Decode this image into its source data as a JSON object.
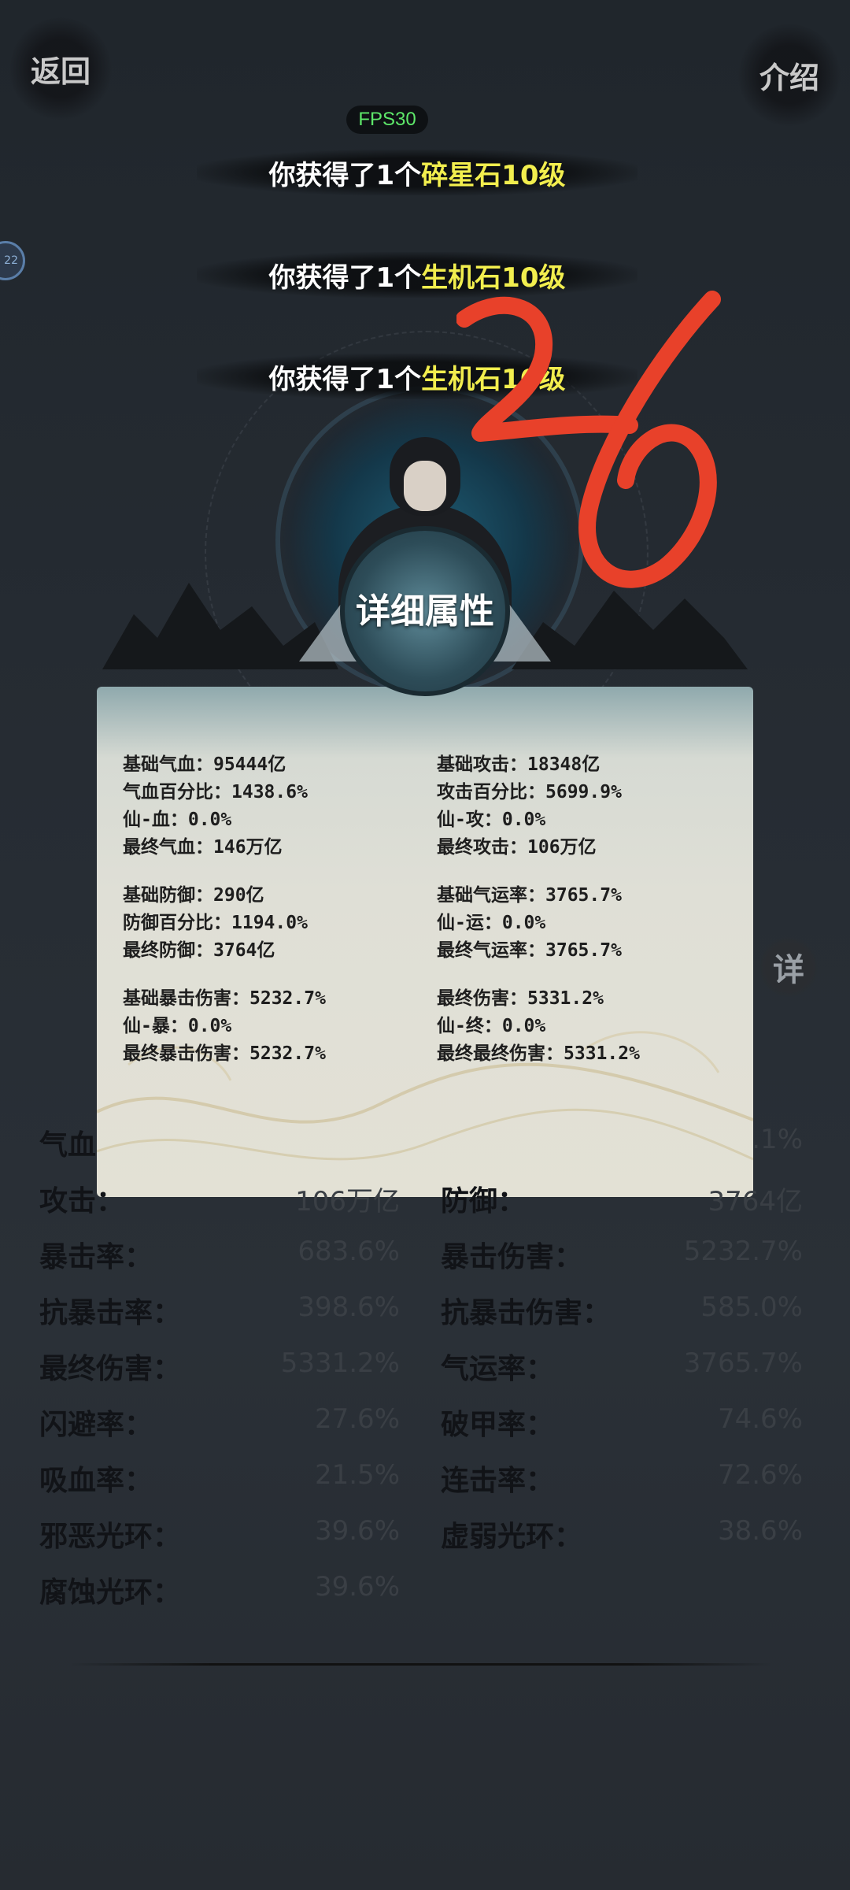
{
  "header": {
    "back_label": "返回",
    "intro_label": "介绍",
    "fps": "FPS30"
  },
  "side_chip": "22",
  "notices": [
    {
      "prefix": "你获得了1个",
      "item": "碎星石10级"
    },
    {
      "prefix": "你获得了1个",
      "item": "生机石10级"
    },
    {
      "prefix": "你获得了1个",
      "item": "生机石10级"
    }
  ],
  "panel": {
    "title": "详细属性",
    "left_groups": [
      [
        "基础气血：95444亿",
        "气血百分比：1438.6%",
        "仙-血：0.0%",
        "最终气血：146万亿"
      ],
      [
        "基础防御：290亿",
        "防御百分比：1194.0%",
        "最终防御：3764亿"
      ],
      [
        "基础暴击伤害：5232.7%",
        "仙-暴：0.0%",
        "最终暴击伤害：5232.7%"
      ]
    ],
    "right_groups": [
      [
        "基础攻击：18348亿",
        "攻击百分比：5699.9%",
        "仙-攻：0.0%",
        "最终攻击：106万亿"
      ],
      [
        "基础气运率：3765.7%",
        "仙-运：0.0%",
        "最终气运率：3765.7%"
      ],
      [
        "最终伤害：5331.2%",
        "仙-终：0.0%",
        "最终最终伤害：5331.2%"
      ]
    ]
  },
  "detail_button": "详",
  "stats": [
    {
      "left_label": "气血",
      "left_value": "",
      "right_label": "",
      "right_value": ".1%"
    },
    {
      "left_label": "攻击：",
      "left_value": "106万亿",
      "right_label": "防御：",
      "right_value": "3764亿"
    },
    {
      "left_label": "暴击率：",
      "left_value": "683.6%",
      "right_label": "暴击伤害：",
      "right_value": "5232.7%"
    },
    {
      "left_label": "抗暴击率：",
      "left_value": "398.6%",
      "right_label": "抗暴击伤害：",
      "right_value": "585.0%"
    },
    {
      "left_label": "最终伤害：",
      "left_value": "5331.2%",
      "right_label": "气运率：",
      "right_value": "3765.7%"
    },
    {
      "left_label": "闪避率：",
      "left_value": "27.6%",
      "right_label": "破甲率：",
      "right_value": "74.6%"
    },
    {
      "left_label": "吸血率：",
      "left_value": "21.5%",
      "right_label": "连击率：",
      "right_value": "72.6%"
    },
    {
      "left_label": "邪恶光环：",
      "left_value": "39.6%",
      "right_label": "虚弱光环：",
      "right_value": "38.6%"
    },
    {
      "left_label": "腐蚀光环：",
      "left_value": "39.6%",
      "right_label": "",
      "right_value": ""
    }
  ],
  "colors": {
    "highlight": "#f2ee4e",
    "fps": "#5ee86a",
    "scribble": "#e8412a"
  }
}
